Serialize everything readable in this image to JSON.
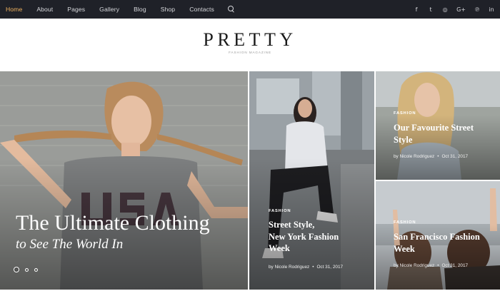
{
  "nav": {
    "items": [
      "Home",
      "About",
      "Pages",
      "Gallery",
      "Blog",
      "Shop",
      "Contacts"
    ],
    "active_color": "#f0b35f"
  },
  "social": {
    "icons": [
      "facebook-icon",
      "twitter-icon",
      "instagram-icon",
      "google-plus-icon",
      "pinterest-icon",
      "linkedin-icon"
    ],
    "glyphs": [
      "f",
      "t",
      "◎",
      "G+",
      "℗",
      "in"
    ]
  },
  "brand": {
    "logo": "PRETTY",
    "tagline": "FASHION MAGAZINE"
  },
  "hero": {
    "title": "The Ultimate Clothing",
    "subtitle": "to See The World In",
    "slides": 3
  },
  "posts": [
    {
      "category": "FASHION",
      "title_lines": [
        "Street Style,",
        "New York Fashion",
        "Week"
      ],
      "author": "by Nicole Rodriguez",
      "date": "Oct 31, 2017"
    },
    {
      "category": "FASHION",
      "title_lines": [
        "Our Favourite Street",
        "Style"
      ],
      "author": "by Nicole Rodriguez",
      "date": "Oct 31, 2017"
    },
    {
      "category": "FASHION",
      "title_lines": [
        "San Francisco Fashion",
        "Week"
      ],
      "author": "by Nicole Rodriguez",
      "date": "Oct 31, 2017"
    }
  ]
}
